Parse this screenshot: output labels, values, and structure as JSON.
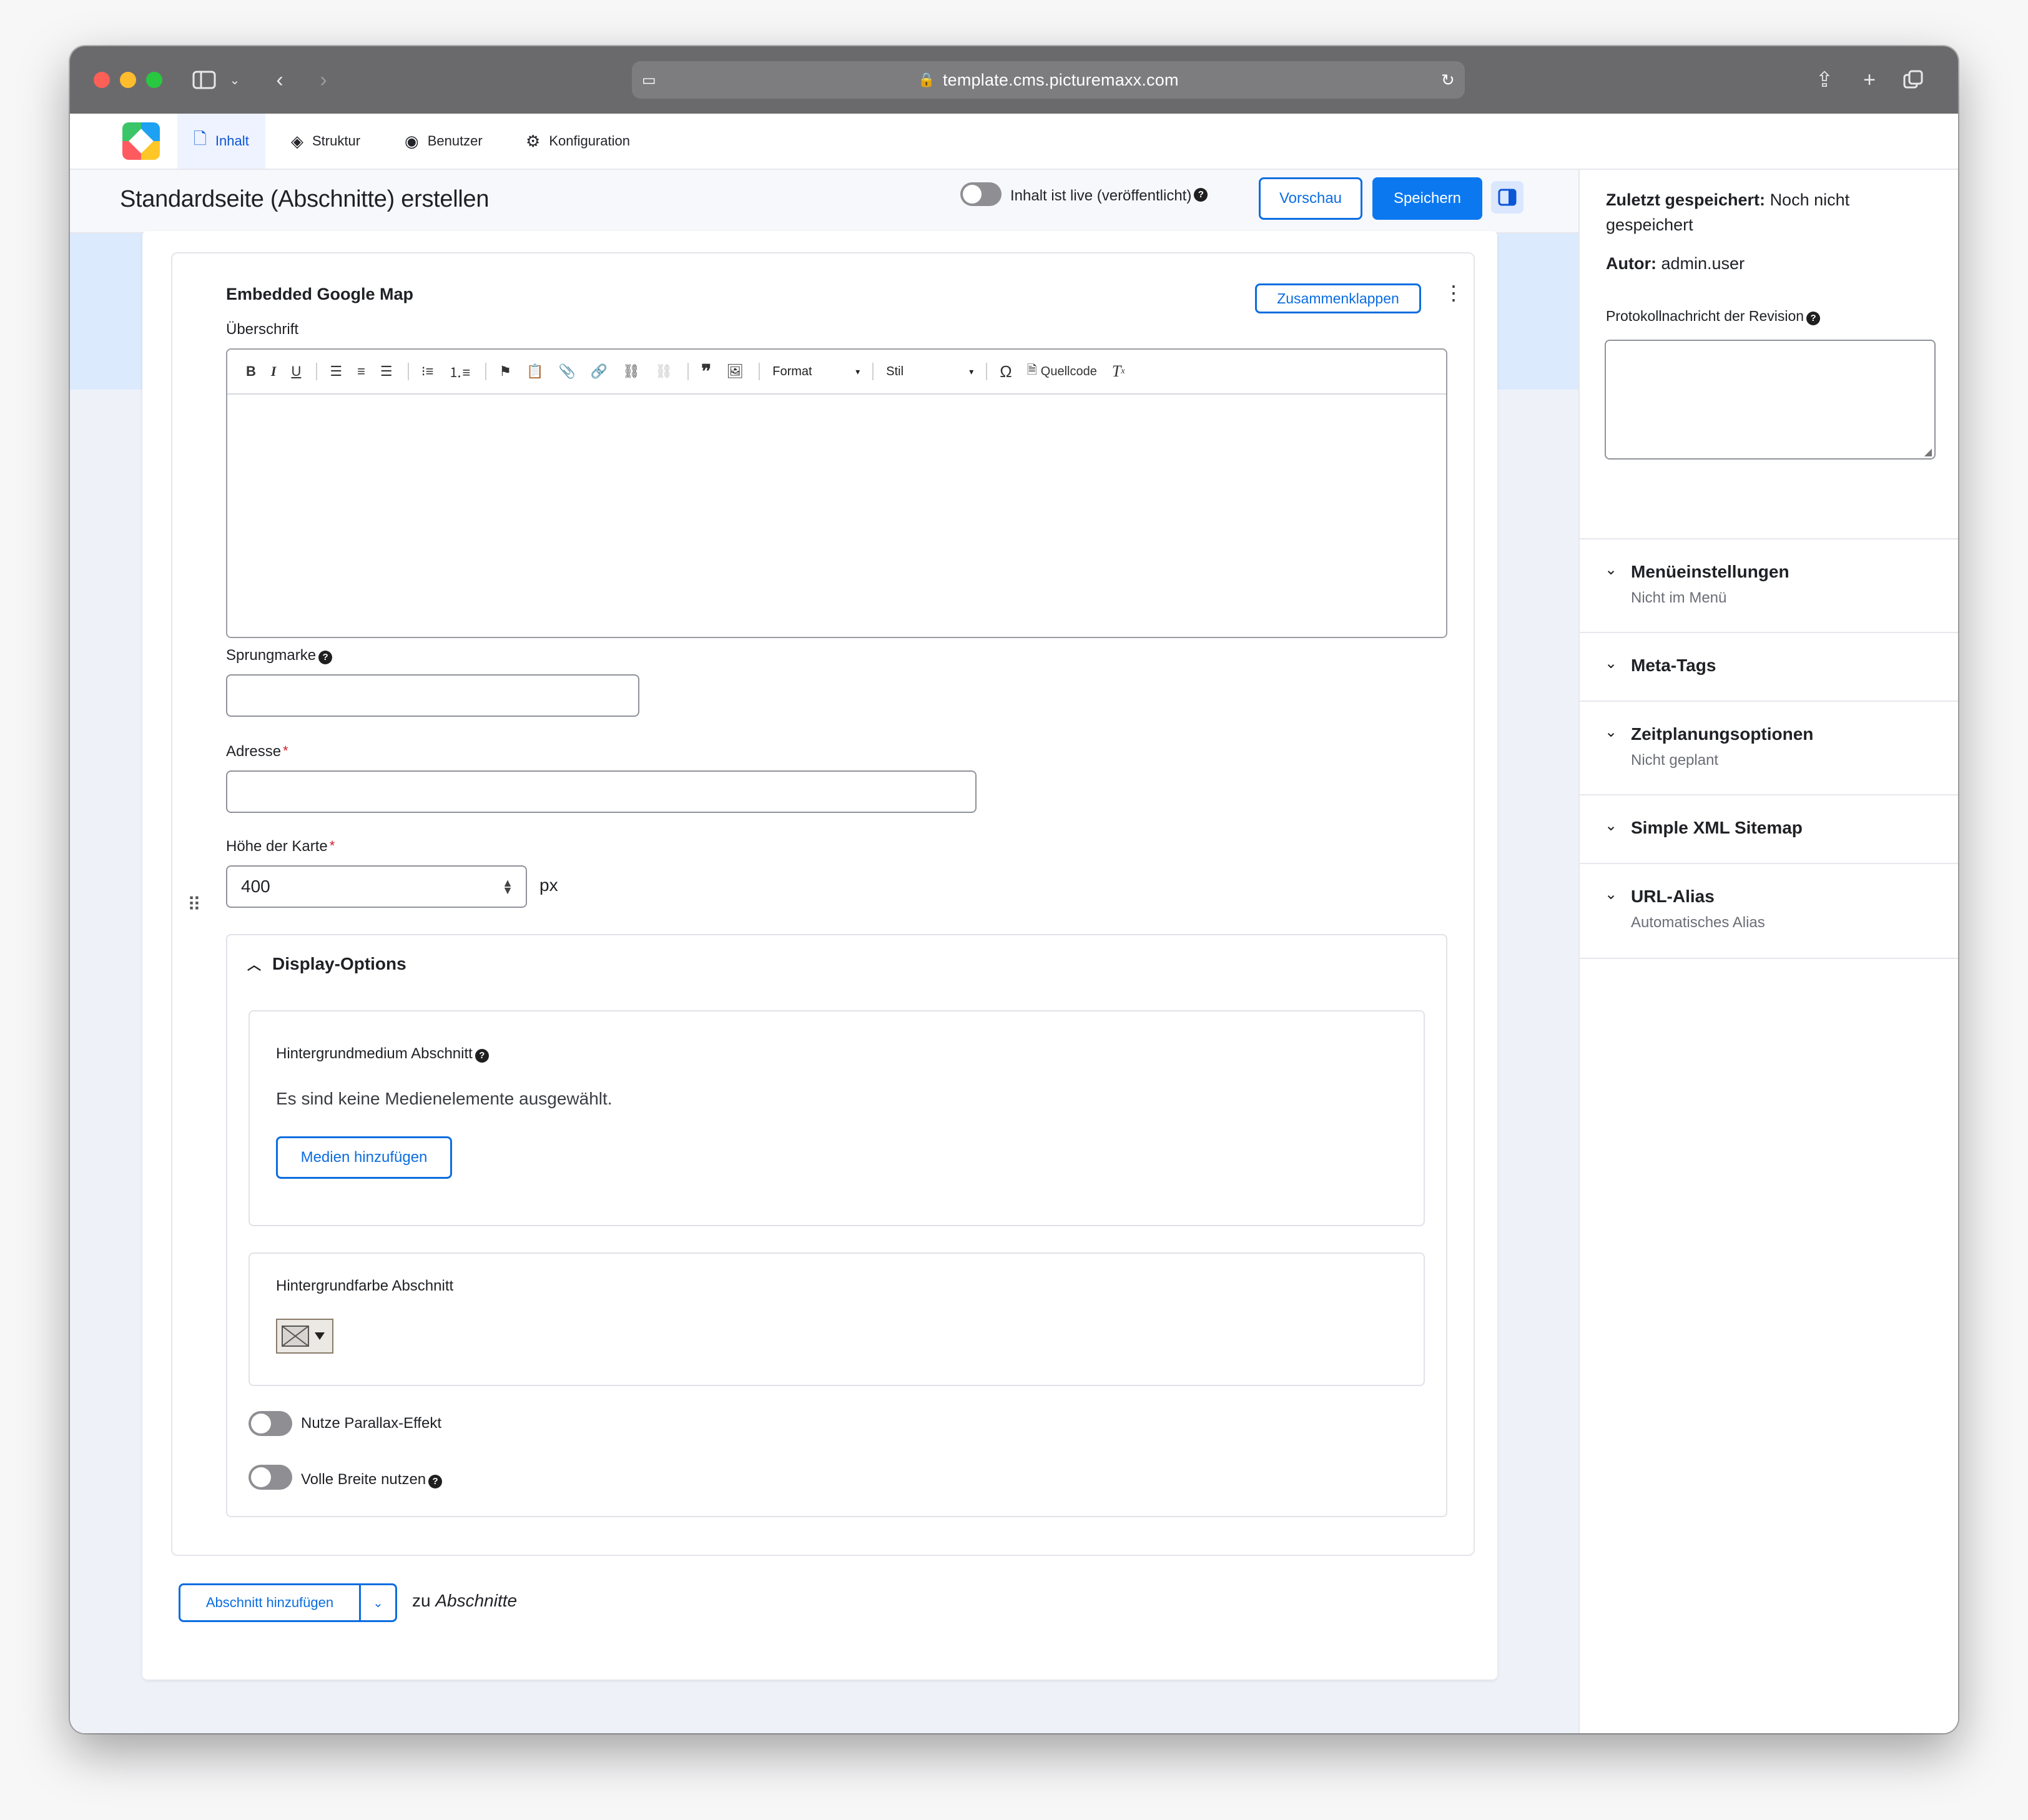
{
  "browser": {
    "url": "template.cms.picturemaxx.com"
  },
  "nav": {
    "tabs": [
      {
        "label": "Inhalt",
        "icon": "document-icon"
      },
      {
        "label": "Struktur",
        "icon": "layers-icon"
      },
      {
        "label": "Benutzer",
        "icon": "user-circle-icon"
      },
      {
        "label": "Konfiguration",
        "icon": "gear-icon"
      }
    ],
    "active_tab": "Inhalt"
  },
  "header": {
    "title": "Standardseite (Abschnitte) erstellen",
    "live_label": "Inhalt ist live (veröffentlicht)",
    "preview_label": "Vorschau",
    "save_label": "Speichern"
  },
  "paragraph": {
    "title": "Embedded Google Map",
    "collapse_label": "Zusammenklappen",
    "heading_label": "Überschrift",
    "toolbar": {
      "format_label": "Format",
      "style_label": "Stil",
      "source_label": "Quellcode"
    },
    "anchor_label": "Sprungmarke",
    "anchor_value": "",
    "address_label": "Adresse",
    "address_value": "",
    "height_label": "Höhe der Karte",
    "height_value": "400",
    "height_unit": "px",
    "display_options": {
      "title": "Display-Options",
      "bg_media_label": "Hintergrundmedium Abschnitt",
      "bg_media_empty": "Es sind keine Medienelemente ausgewählt.",
      "add_media_label": "Medien hinzufügen",
      "bg_color_label": "Hintergrundfarbe Abschnitt",
      "parallax_label": "Nutze Parallax-Effekt",
      "parallax_enabled": false,
      "full_width_label": "Volle Breite nutzen",
      "full_width_enabled": false
    }
  },
  "add_section": {
    "button_label": "Abschnitt hinzufügen",
    "suffix_prefix": "zu",
    "suffix_target": "Abschnitte"
  },
  "sidebar": {
    "last_saved_label": "Zuletzt gespeichert:",
    "last_saved_value": "Noch nicht gespeichert",
    "author_label": "Autor:",
    "author_value": "admin.user",
    "revision_label": "Protokollnachricht der Revision",
    "sections": [
      {
        "title": "Menüeinstellungen",
        "subtitle": "Nicht im Menü"
      },
      {
        "title": "Meta-Tags",
        "subtitle": ""
      },
      {
        "title": "Zeitplanungsoptionen",
        "subtitle": "Nicht geplant"
      },
      {
        "title": "Simple XML Sitemap",
        "subtitle": ""
      },
      {
        "title": "URL-Alias",
        "subtitle": "Automatisches Alias"
      }
    ]
  },
  "colors": {
    "accent": "#0b78f0",
    "accent_dark": "#0b56d6",
    "required": "#d1202a",
    "chrome": "#6a6a6c"
  },
  "live_published": false
}
